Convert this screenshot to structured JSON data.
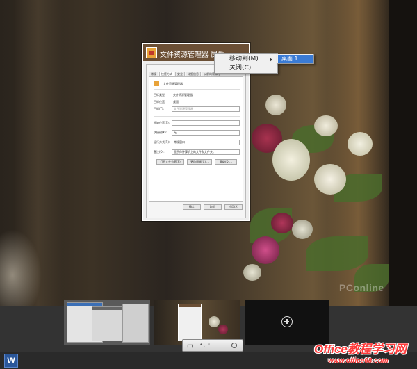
{
  "window": {
    "title": "文件资源管理器 属性"
  },
  "properties_dialog": {
    "tabs": [
      "常规",
      "快捷方式",
      "安全",
      "详细信息",
      "以前的版本"
    ],
    "header_name": "文件资源管理器",
    "fields": [
      {
        "label": "目标类型:",
        "value": "文件资源管理器"
      },
      {
        "label": "目标位置:",
        "value": "桌面"
      },
      {
        "label": "目标(T):",
        "value": "文件资源管理器"
      }
    ],
    "inputs": [
      {
        "label": "起始位置(S):",
        "value": ""
      },
      {
        "label": "快捷键(K):",
        "value": "无"
      },
      {
        "label": "运行方式(R):",
        "value": "常规窗口"
      },
      {
        "label": "备注(O):",
        "value": "显示你计算机上的文件和文件夹。"
      }
    ],
    "action_buttons": [
      "打开文件位置(F)",
      "更改图标(C)...",
      "高级(D)..."
    ],
    "footer_buttons": [
      "确定",
      "取消",
      "应用(A)"
    ]
  },
  "context_menu": {
    "items": [
      {
        "label": "移动到(M)",
        "has_submenu": true
      },
      {
        "label": "关闭(C)",
        "has_submenu": false
      }
    ],
    "submenu": {
      "items": [
        {
          "label": "桌面 1",
          "selected": true
        }
      ]
    }
  },
  "taskbar": {
    "word_icon_letter": "W"
  },
  "ime_toolbar": {
    "mode": "中",
    "symbols": "•, ◦"
  },
  "watermark": {
    "text": "PConline"
  },
  "site_logo": {
    "brand": "Office教程学习网",
    "url": "www.office68.com"
  },
  "colors": {
    "menu_highlight": "#3a7bd5",
    "strip_background": "#333333",
    "logo_red": "#ff3a3a"
  }
}
